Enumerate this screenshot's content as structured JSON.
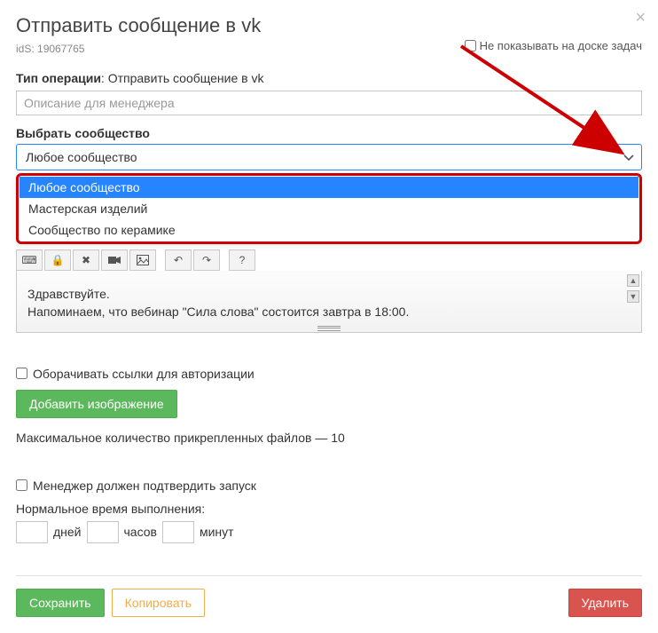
{
  "modal": {
    "title": "Отправить сообщение в vk",
    "ids_label": "idS:",
    "ids_value": "19067765",
    "hide_on_board": "Не показывать на доске задач"
  },
  "optype": {
    "label": "Тип операции",
    "value": "Отправить сообщение в vk",
    "description_placeholder": "Описание для менеджера"
  },
  "community": {
    "label": "Выбрать сообщество",
    "selected": "Любое сообщество",
    "options": [
      "Любое сообщество",
      "Мастерская изделий",
      "Сообщество по керамике"
    ]
  },
  "toolbar": {
    "keyboard_icon": "⌨",
    "lock_icon": "🔒",
    "clear_icon": "✖",
    "video_icon": "■",
    "image_icon": "🖼",
    "undo_icon": "↶",
    "redo_icon": "↷",
    "help_icon": "?"
  },
  "message": {
    "line1": "Здравствуйте.",
    "line2": "Напоминаем, что вебинар \"Сила слова\" состоится завтра в 18:00."
  },
  "wrap_links": "Оборачивать ссылки для авторизации",
  "add_image_btn": "Добавить изображение",
  "max_files_note": "Максимальное количество прикрепленных файлов — 10",
  "manager_confirm": "Менеджер должен подтвердить запуск",
  "normal_time_label": "Нормальное время выполнения:",
  "time_units": {
    "days": "дней",
    "hours": "часов",
    "minutes": "минут"
  },
  "footer": {
    "save": "Сохранить",
    "copy": "Копировать",
    "delete": "Удалить"
  }
}
